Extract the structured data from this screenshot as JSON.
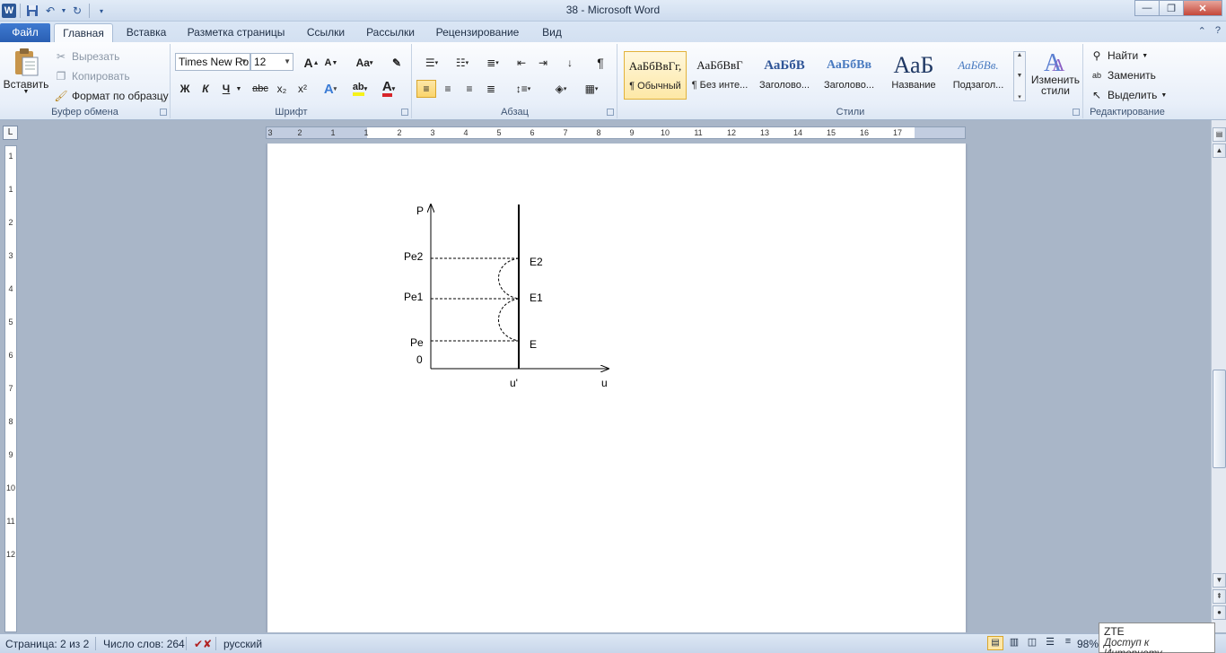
{
  "window": {
    "title": "38  -  Microsoft Word",
    "controls": {
      "minimize": "—",
      "maximize": "❐",
      "close": "✕"
    }
  },
  "quick_access": {
    "app_icon": "W",
    "save_icon": "save-icon",
    "undo_icon": "undo-icon",
    "redo_icon": "redo-icon"
  },
  "tabs": [
    {
      "label": "Файл"
    },
    {
      "label": "Главная"
    },
    {
      "label": "Вставка"
    },
    {
      "label": "Разметка страницы"
    },
    {
      "label": "Ссылки"
    },
    {
      "label": "Рассылки"
    },
    {
      "label": "Рецензирование"
    },
    {
      "label": "Вид"
    }
  ],
  "ribbon": {
    "clipboard": {
      "label": "Буфер обмена",
      "paste": "Вставить",
      "cut": "Вырезать",
      "copy": "Копировать",
      "format_painter": "Формат по образцу"
    },
    "font": {
      "label": "Шрифт",
      "font_name": "Times New Ro",
      "font_size": "12",
      "grow": "A",
      "shrink": "A",
      "case": "Aa",
      "bold": "Ж",
      "italic": "К",
      "underline": "Ч",
      "strike": "abc",
      "sub": "x₂",
      "sup": "x²",
      "font_color": "A",
      "highlight": "ab"
    },
    "paragraph": {
      "label": "Абзац",
      "pilcrow": "¶"
    },
    "styles": {
      "label": "Стили",
      "items": [
        {
          "sample": "АаБбВвГг,",
          "name": "¶ Обычный"
        },
        {
          "sample": "АаБбВвГ",
          "name": "¶ Без инте..."
        },
        {
          "sample": "АаБбВ",
          "name": "Заголово..."
        },
        {
          "sample": "АаБбВв",
          "name": "Заголово..."
        },
        {
          "sample": "АаБ",
          "name": "Название"
        },
        {
          "sample": "АаБбВв.",
          "name": "Подзагол..."
        }
      ],
      "change_styles": "Изменить стили"
    },
    "editing": {
      "label": "Редактирование",
      "find": "Найти",
      "replace": "Заменить",
      "select": "Выделить"
    }
  },
  "ruler": {
    "corner": "L",
    "h_numbers": [
      "3",
      "2",
      "1",
      "1",
      "2",
      "3",
      "4",
      "5",
      "6",
      "7",
      "8",
      "9",
      "10",
      "11",
      "12",
      "13",
      "14",
      "15",
      "16",
      "17"
    ],
    "v_numbers": [
      "1",
      "1",
      "2",
      "3",
      "4",
      "5",
      "6",
      "7",
      "8",
      "9",
      "10",
      "11",
      "12"
    ]
  },
  "diagram": {
    "y_axis_label": "P",
    "x_axis_label": "u",
    "x_marker": "u'",
    "origin": "0",
    "left_labels": [
      "Pe2",
      "Pe1",
      "Pe"
    ],
    "right_labels": [
      "E2",
      "E1",
      "E"
    ]
  },
  "statusbar": {
    "page": "Страница: 2 из 2",
    "words": "Число слов: 264",
    "language": "русский",
    "zoom": "98%"
  },
  "tooltip": {
    "line1": "ZTE",
    "line2": "Доступ к Интернету"
  }
}
